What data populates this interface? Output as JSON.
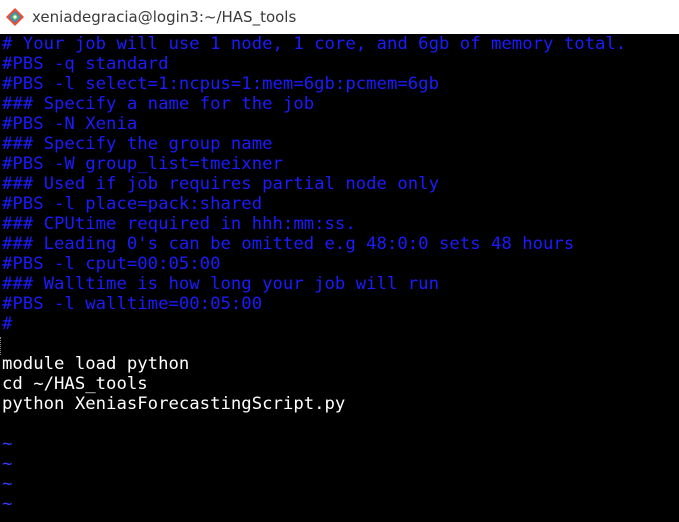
{
  "window": {
    "title": "xeniadegracia@login3:~/HAS_tools",
    "icon": "git-bash-diamond-icon",
    "colors": {
      "titlebar_bg": "#ffffff",
      "terminal_bg": "#000000",
      "comment_blue": "#1b1bff",
      "text_white": "#ffffff"
    }
  },
  "editor": {
    "lines": [
      "# Your job will use 1 node, 1 core, and 6gb of memory total.",
      "#PBS -q standard",
      "#PBS -l select=1:ncpus=1:mem=6gb:pcmem=6gb",
      "### Specify a name for the job",
      "#PBS -N Xenia",
      "### Specify the group name",
      "#PBS -W group_list=tmeixner",
      "### Used if job requires partial node only",
      "#PBS -l place=pack:shared",
      "### CPUtime required in hhh:mm:ss.",
      "### Leading 0's can be omitted e.g 48:0:0 sets 48 hours",
      "#PBS -l cput=00:05:00",
      "### Walltime is how long your job will run",
      "#PBS -l walltime=00:05:00",
      "#",
      "",
      "module load python",
      "cd ~/HAS_tools",
      "python XeniasForecastingScript.py",
      "",
      "~",
      "~",
      "~",
      "~"
    ]
  }
}
